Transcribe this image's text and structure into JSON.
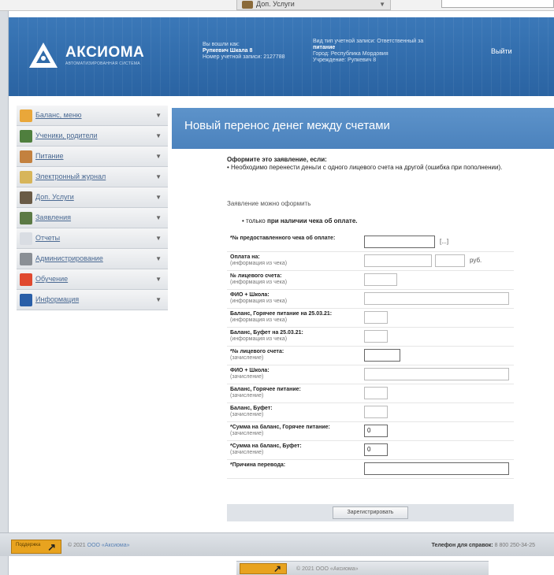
{
  "top_tab": {
    "label": "Доп. Услуги"
  },
  "header": {
    "brand": "АКСИОМА",
    "brand_sub": "АВТОМАТИЗИРОВАННАЯ СИСТЕМА",
    "info_left": [
      "Вы вошли как:",
      "Рупкевич Шкала 8",
      "Номер учетной записи: 2127788"
    ],
    "info_right": [
      "Вид тип учетной записи: Ответственный за",
      "питание",
      "Город: Республика Мордовия",
      "Учреждение: Рупкевич 8"
    ],
    "exit": "Выйти"
  },
  "sidebar": {
    "items": [
      {
        "label": "Баланс, меню",
        "icon": "balance-icon",
        "color": "#e9a73a"
      },
      {
        "label": "Ученики, родители",
        "icon": "students-icon",
        "color": "#4f7f3e"
      },
      {
        "label": "Питание",
        "icon": "food-icon",
        "color": "#c3813f"
      },
      {
        "label": "Электронный журнал",
        "icon": "journal-icon",
        "color": "#d7b55a"
      },
      {
        "label": "Доп. Услуги",
        "icon": "services-icon",
        "color": "#6a5b47"
      },
      {
        "label": "Заявления",
        "icon": "requests-icon",
        "color": "#5c7a45"
      },
      {
        "label": "Отчеты",
        "icon": "reports-icon",
        "color": "#d9dde3"
      },
      {
        "label": "Администрирование",
        "icon": "admin-icon",
        "color": "#8a8f95"
      },
      {
        "label": "Обучение",
        "icon": "learning-icon",
        "color": "#e0492f"
      },
      {
        "label": "Информация",
        "icon": "info-icon",
        "color": "#2a5fa8"
      }
    ]
  },
  "content": {
    "title": "Новый перенос денег между счетами",
    "note_head": "Оформите это заявление, если:",
    "note_body": "• Необходимо перенести деньги с одного лицевого счета на другой (ошибка при пополнении).",
    "note2": "Заявление можно оформить",
    "note3_prefix": "• только",
    "note3_bold": "при наличии чека об оплате."
  },
  "form": {
    "rows": [
      {
        "label": "*№ предоставленного чека об оплате:",
        "sub": "",
        "value": "",
        "extra": "[...]"
      },
      {
        "label": "Оплата на:",
        "sub": "(информация из чека)",
        "value": "",
        "extra": "руб."
      },
      {
        "label": "№ лицевого счета:",
        "sub": "(информация из чека)",
        "value": "",
        "extra": ""
      },
      {
        "label": "ФИО + Школа:",
        "sub": "(информация из чека)",
        "value": "",
        "extra": ""
      },
      {
        "label": "Баланс, Горячее питание на 25.03.21:",
        "sub": "(информация из чека)",
        "value": "",
        "extra": ""
      },
      {
        "label": "Баланс, Буфет на 25.03.21:",
        "sub": "(информация из чека)",
        "value": "",
        "extra": ""
      },
      {
        "label": "*№ лицевого счета:",
        "sub": "(зачисление)",
        "value": "",
        "extra": ""
      },
      {
        "label": "ФИО + Школа:",
        "sub": "(зачисление)",
        "value": "",
        "extra": ""
      },
      {
        "label": "Баланс, Горячее питание:",
        "sub": "(зачисление)",
        "value": "",
        "extra": ""
      },
      {
        "label": "Баланс, Буфет:",
        "sub": "(зачисление)",
        "value": "",
        "extra": ""
      },
      {
        "label": "*Сумма на баланс, Горячее питание:",
        "sub": "(зачисление)",
        "value": "0",
        "extra": ""
      },
      {
        "label": "*Сумма на баланс, Буфет:",
        "sub": "(зачисление)",
        "value": "0",
        "extra": ""
      },
      {
        "label": "*Причина перевода:",
        "sub": "",
        "value": "",
        "extra": ""
      }
    ],
    "submit": "Зарегистрировать"
  },
  "footer": {
    "badge": "Поддержка",
    "copyright": "© 2021",
    "copyright_link": "ООО «Аксиома»",
    "phone_label": "Телефон для справок:",
    "phone": "8 800 250-34-25"
  }
}
